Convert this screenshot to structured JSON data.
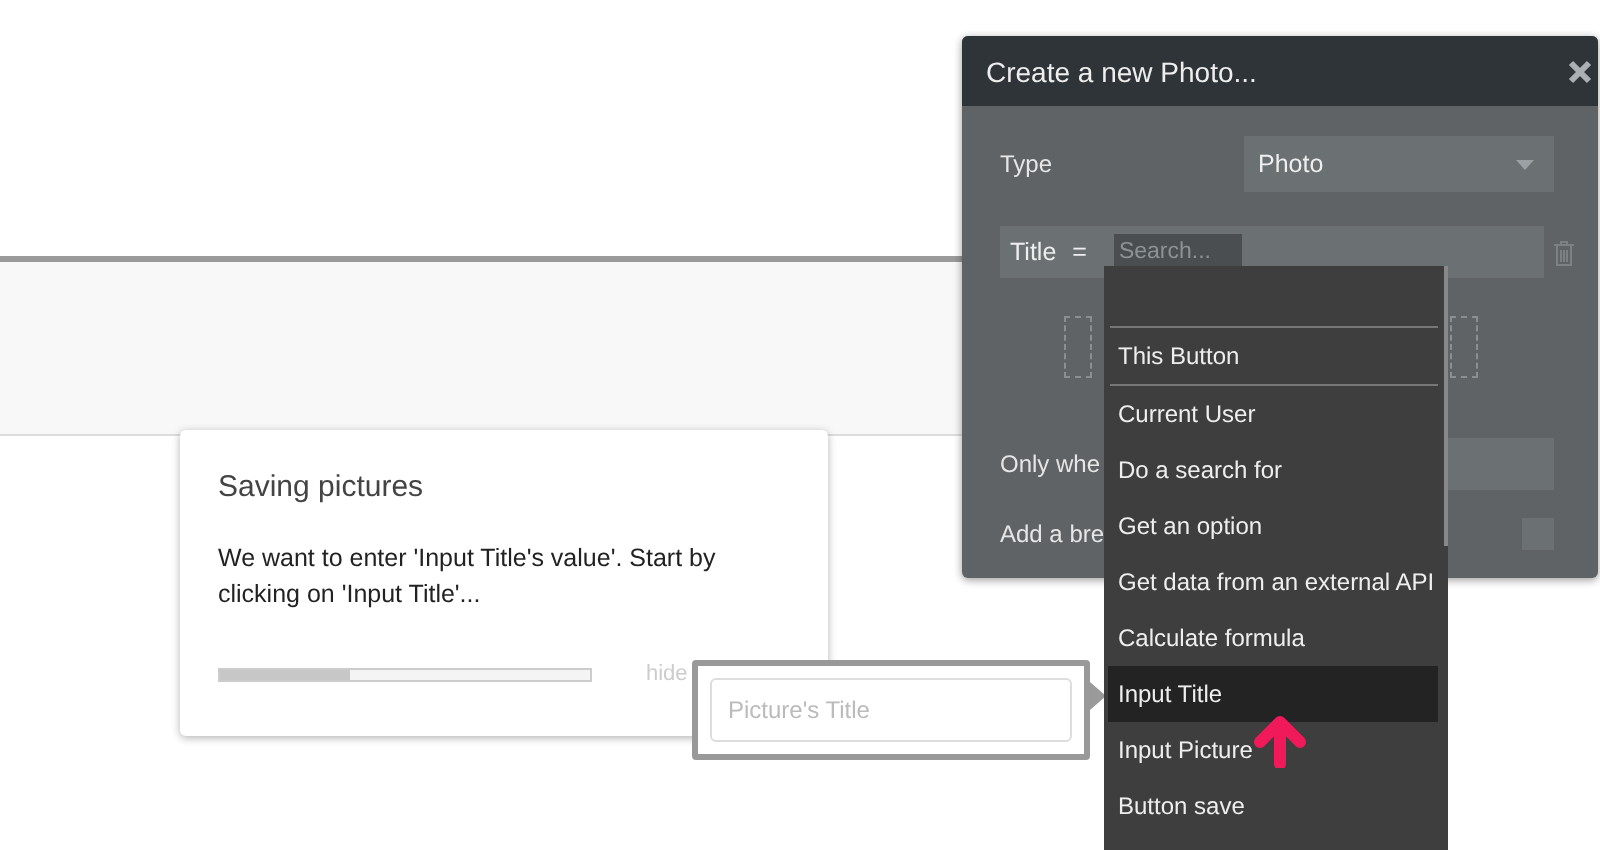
{
  "tutorial": {
    "title": "Saving pictures",
    "text": "We want to enter 'Input Title's value'. Start by clicking on 'Input Title'...",
    "level": 0.35,
    "hide": "hide"
  },
  "highlighted_input": {
    "placeholder": "Picture's Title"
  },
  "dialog": {
    "title": "Create a new Photo...",
    "type_field": {
      "label": "Type",
      "value": "Photo"
    },
    "title_field": {
      "label": "Title",
      "operator": "=",
      "placeholder": "Search..."
    },
    "only_when": {
      "label": "Only whe"
    },
    "breakpoint": {
      "label": "Add a bre",
      "checked": false
    }
  },
  "dropdown": {
    "items": [
      {
        "label": "This Button",
        "separated": true,
        "selected": false
      },
      {
        "label": "Current User",
        "separated": true,
        "selected": false
      },
      {
        "label": "Do a search for",
        "separated": false,
        "selected": false
      },
      {
        "label": "Get an option",
        "separated": false,
        "selected": false
      },
      {
        "label": "Get data from an external API",
        "separated": false,
        "selected": false
      },
      {
        "label": "Calculate formula",
        "separated": false,
        "selected": false
      },
      {
        "label": "Input Title",
        "separated": false,
        "selected": true
      },
      {
        "label": "Input Picture",
        "separated": false,
        "selected": false
      },
      {
        "label": "Button save",
        "separated": false,
        "selected": false
      }
    ]
  }
}
